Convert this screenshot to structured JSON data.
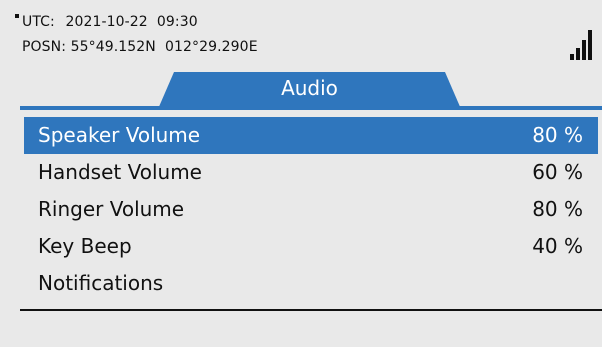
{
  "status": {
    "utc_label": "UTC:",
    "utc_value": "2021-10-22  09:30",
    "posn_label": "POSN:",
    "posn_value": "55°49.152N  012°29.290E",
    "signal_icon": "signal-strength-icon",
    "signal_bars": 4
  },
  "tab": {
    "label": "Audio"
  },
  "colors": {
    "accent": "#2f76bd",
    "background": "#e9e9e9"
  },
  "menu": {
    "items": [
      {
        "label": "Speaker Volume",
        "value": "80 %",
        "selected": true
      },
      {
        "label": "Handset Volume",
        "value": "60 %",
        "selected": false
      },
      {
        "label": "Ringer Volume",
        "value": "80 %",
        "selected": false
      },
      {
        "label": "Key Beep",
        "value": "40 %",
        "selected": false
      },
      {
        "label": "Notifications",
        "value": "",
        "selected": false
      }
    ]
  }
}
